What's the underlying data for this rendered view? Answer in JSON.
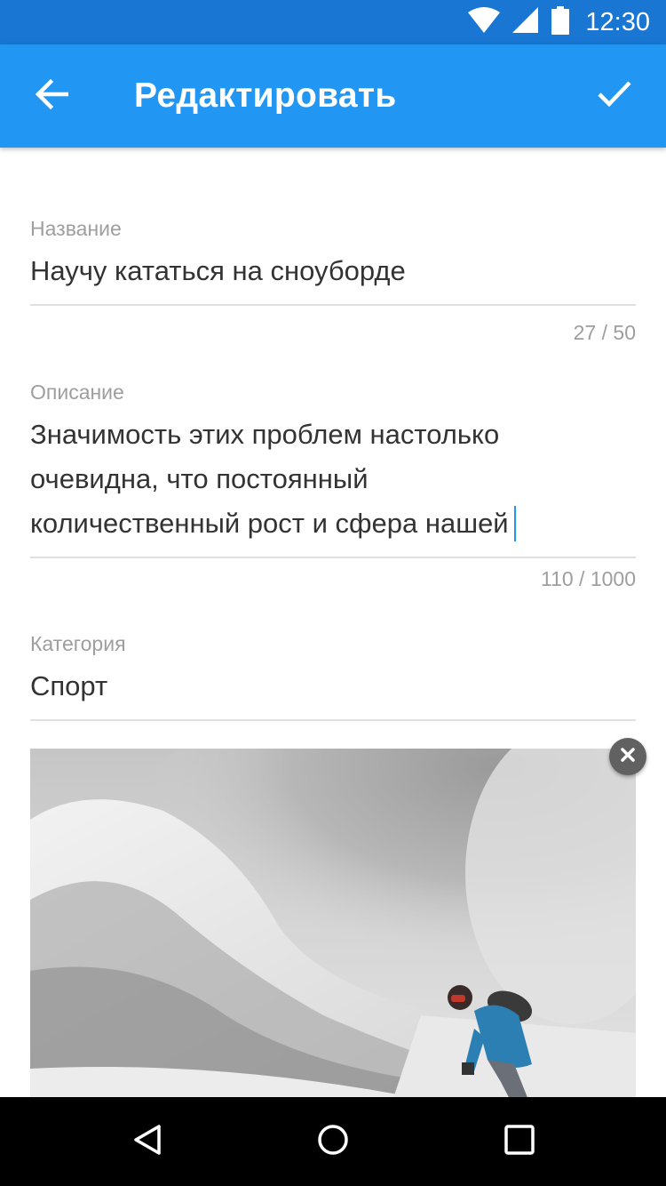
{
  "status_bar": {
    "time": "12:30",
    "icons": [
      "wifi-icon",
      "signal-icon",
      "battery-icon"
    ]
  },
  "app_bar": {
    "title": "Редактировать",
    "back_icon": "arrow-back-icon",
    "confirm_icon": "check-icon"
  },
  "form": {
    "name": {
      "label": "Название",
      "value": "Научу кататься на сноуборде",
      "counter": "27 / 50"
    },
    "description": {
      "label": "Описание",
      "lines": [
        "Значимость этих проблем настолько",
        "очевидна, что постоянный",
        "количественный рост и сфера нашей"
      ],
      "counter": "110 / 1000"
    },
    "category": {
      "label": "Категория",
      "value": "Спорт"
    },
    "photo": {
      "remove_icon": "close-icon"
    }
  },
  "nav_bar": {
    "icons": [
      "nav-back-icon",
      "home-icon",
      "recents-icon"
    ]
  },
  "colors": {
    "status_bar": "#1976D2",
    "app_bar": "#2196F3",
    "accent": "#2196F3",
    "label": "#9E9E9E",
    "text": "#333333",
    "divider": "#E0E0E0"
  }
}
